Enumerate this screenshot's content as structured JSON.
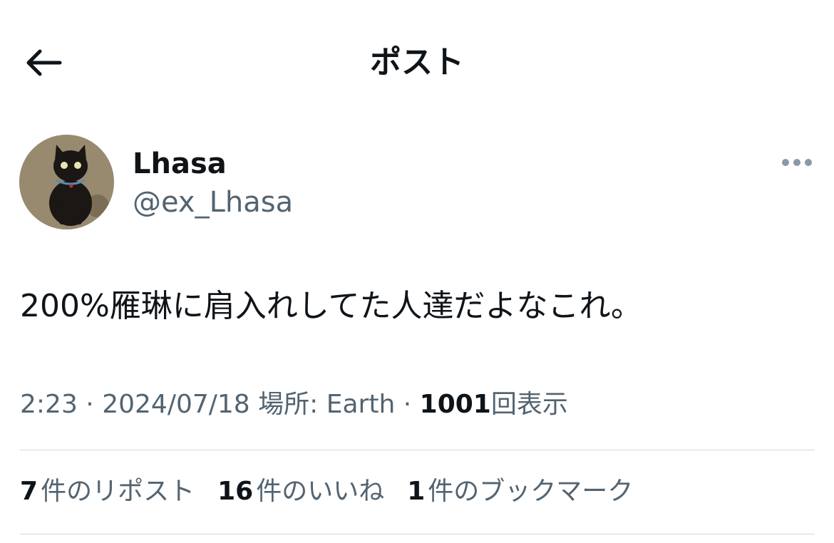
{
  "header": {
    "back_icon": "arrow-left-icon",
    "title": "ポスト"
  },
  "author": {
    "display_name": "Lhasa",
    "handle": "@ex_Lhasa",
    "avatar_icon": "black-cat-avatar",
    "more_icon": "more-horizontal-icon"
  },
  "post": {
    "text": "200%雁琳に肩入れしてた人達だよなこれ。"
  },
  "meta": {
    "time": "2:23",
    "separator": "·",
    "date": "2024/07/18",
    "location": "場所: Earth",
    "views_count": "1001",
    "views_label": "回表示"
  },
  "stats": {
    "reposts_count": "7",
    "reposts_label": "件のリポスト",
    "likes_count": "16",
    "likes_label": "件のいいね",
    "bookmarks_count": "1",
    "bookmarks_label": "件のブックマーク"
  },
  "colors": {
    "text_primary": "#0f1419",
    "text_secondary": "#536471",
    "divider": "#cfd9de"
  }
}
